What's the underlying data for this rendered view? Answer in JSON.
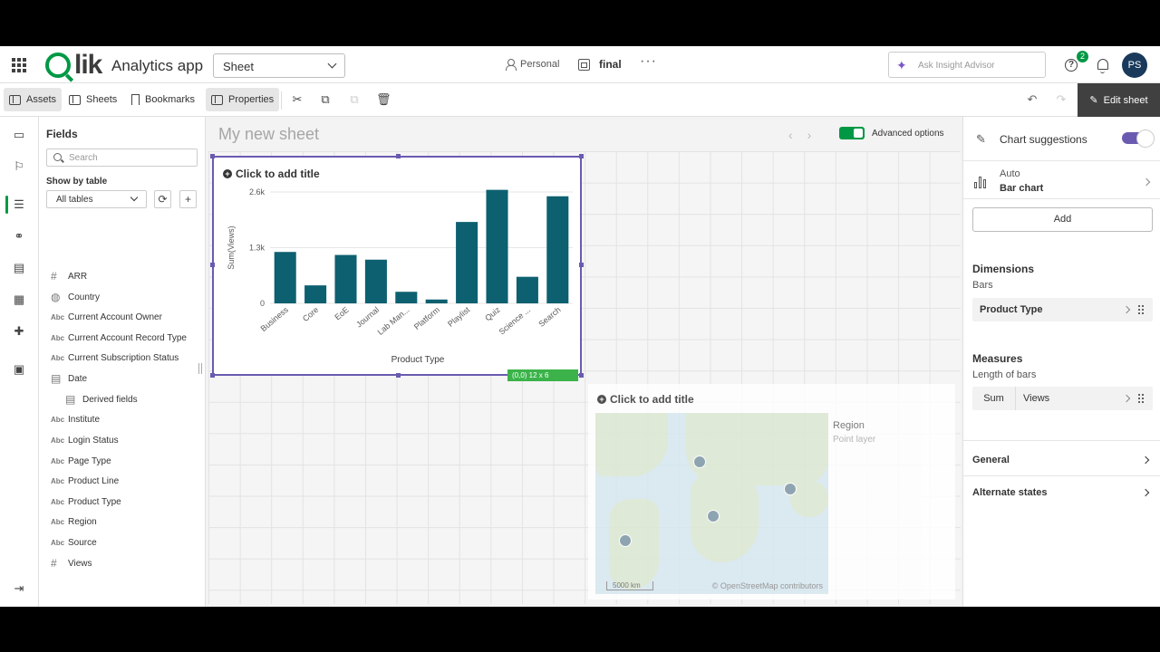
{
  "header": {
    "logo_text": "lik",
    "app_title": "Analytics app",
    "sheet_select": "Sheet",
    "space": "Personal",
    "app_name": "final",
    "more": "···",
    "insight_placeholder": "Ask Insight Advisor",
    "help_badge": "2",
    "avatar_initials": "PS"
  },
  "toolbar": {
    "assets": "Assets",
    "sheets": "Sheets",
    "bookmarks": "Bookmarks",
    "properties": "Properties",
    "edit_sheet": "Edit sheet"
  },
  "fields_panel": {
    "title": "Fields",
    "search_placeholder": "Search",
    "show_by_table": "Show by table",
    "table_select": "All tables",
    "items": [
      {
        "type": "#",
        "name": "ARR"
      },
      {
        "type": "globe",
        "name": "Country"
      },
      {
        "type": "Abc",
        "name": "Current Account Owner"
      },
      {
        "type": "Abc",
        "name": "Current Account Record Type"
      },
      {
        "type": "Abc",
        "name": "Current Subscription Status"
      },
      {
        "type": "cal",
        "name": "Date"
      },
      {
        "type": "cal",
        "name": "Derived fields"
      },
      {
        "type": "Abc",
        "name": "Institute"
      },
      {
        "type": "Abc",
        "name": "Login Status"
      },
      {
        "type": "Abc",
        "name": "Page Type"
      },
      {
        "type": "Abc",
        "name": "Product Line"
      },
      {
        "type": "Abc",
        "name": "Product Type"
      },
      {
        "type": "Abc",
        "name": "Region"
      },
      {
        "type": "Abc",
        "name": "Source"
      },
      {
        "type": "#",
        "name": "Views"
      }
    ]
  },
  "canvas": {
    "sheet_title": "My new sheet",
    "advanced_options": "Advanced options",
    "bar_card": {
      "add_title": "Click to add title",
      "size_badge": "(0,0)  12 x 6"
    },
    "map_card": {
      "add_title": "Click to add title",
      "region": "Region",
      "point_layer": "Point layer",
      "scale": "5000 km",
      "attribution": "© OpenStreetMap contributors"
    }
  },
  "chart_data": {
    "type": "bar",
    "categories": [
      "Business",
      "Core",
      "EoE",
      "Journal",
      "Lab Man...",
      "Platform",
      "Playlist",
      "Quiz",
      "Science ...",
      "Search"
    ],
    "values": [
      1200,
      420,
      1130,
      1020,
      270,
      90,
      1900,
      2650,
      620,
      2500
    ],
    "xlabel": "Product Type",
    "ylabel": "Sum(Views)",
    "yticks": [
      "0",
      "1.3k",
      "2.6k"
    ],
    "ylim": [
      0,
      2600
    ],
    "color": "#0d6070",
    "grid": true
  },
  "properties": {
    "chart_suggestions": "Chart suggestions",
    "auto": "Auto",
    "bar_chart": "Bar chart",
    "add": "Add",
    "dimensions": "Dimensions",
    "bars": "Bars",
    "dimension_field": "Product Type",
    "measures": "Measures",
    "length_of_bars": "Length of bars",
    "measure_agg": "Sum",
    "measure_field": "Views",
    "general": "General",
    "alternate_states": "Alternate states"
  }
}
